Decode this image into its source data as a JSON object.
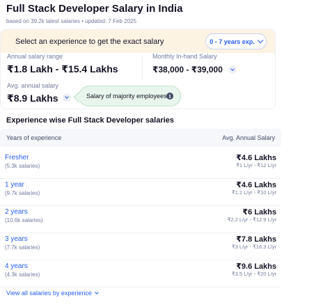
{
  "header": {
    "title": "Full Stack Developer Salary in India",
    "subtitle": "based on 39.2k latest salaries • updated: 7 Feb 2025"
  },
  "filter": {
    "banner_text": "Select an experience to get the exact salary",
    "selected_experience": "0 - 7 years exp."
  },
  "summary": {
    "annual_range_label": "Annual salary range",
    "annual_range_value": "₹1.8 Lakh - ₹15.4 Lakhs",
    "monthly_label": "Monthly In-hand Salary",
    "monthly_value": "₹38,000 - ₹39,000",
    "avg_label": "Avg. annual salary",
    "avg_value": "₹8.9 Lakhs",
    "tooltip_text": "Salary of majority employees",
    "info_glyph": "i"
  },
  "table": {
    "section_title": "Experience wise Full Stack Developer salaries",
    "col_experience": "Years of experience",
    "col_salary": "Avg. Annual Salary",
    "rows": [
      {
        "experience": "Fresher",
        "count": "(5.3k salaries)",
        "avg": "₹4.6 Lakhs",
        "range": "₹1 L/yr - ₹12 L/yr"
      },
      {
        "experience": "1 year",
        "count": "(9.7k salaries)",
        "avg": "₹4.6 Lakhs",
        "range": "₹1.2 L/yr - ₹10 L/yr"
      },
      {
        "experience": "2 years",
        "count": "(10.6k salaries)",
        "avg": "₹6 Lakhs",
        "range": "₹2.2 L/yr - ₹12.9 L/yr"
      },
      {
        "experience": "3 years",
        "count": "(7.7k salaries)",
        "avg": "₹7.8 Lakhs",
        "range": "₹3 L/yr - ₹16.3 L/yr"
      },
      {
        "experience": "4 years",
        "count": "(4.3k salaries)",
        "avg": "₹9.6 Lakhs",
        "range": "₹3.5 L/yr - ₹20 L/yr"
      }
    ],
    "view_all": "View all salaries by experience"
  },
  "icons": {
    "dropdown": "chevron-down-icon",
    "info": "info-icon"
  },
  "colors": {
    "accent": "#275df5",
    "banner_bg": "#fdf3e3",
    "tooltip_bg": "#e8f5ec",
    "text_primary": "#121224",
    "text_secondary": "#717b9e"
  }
}
